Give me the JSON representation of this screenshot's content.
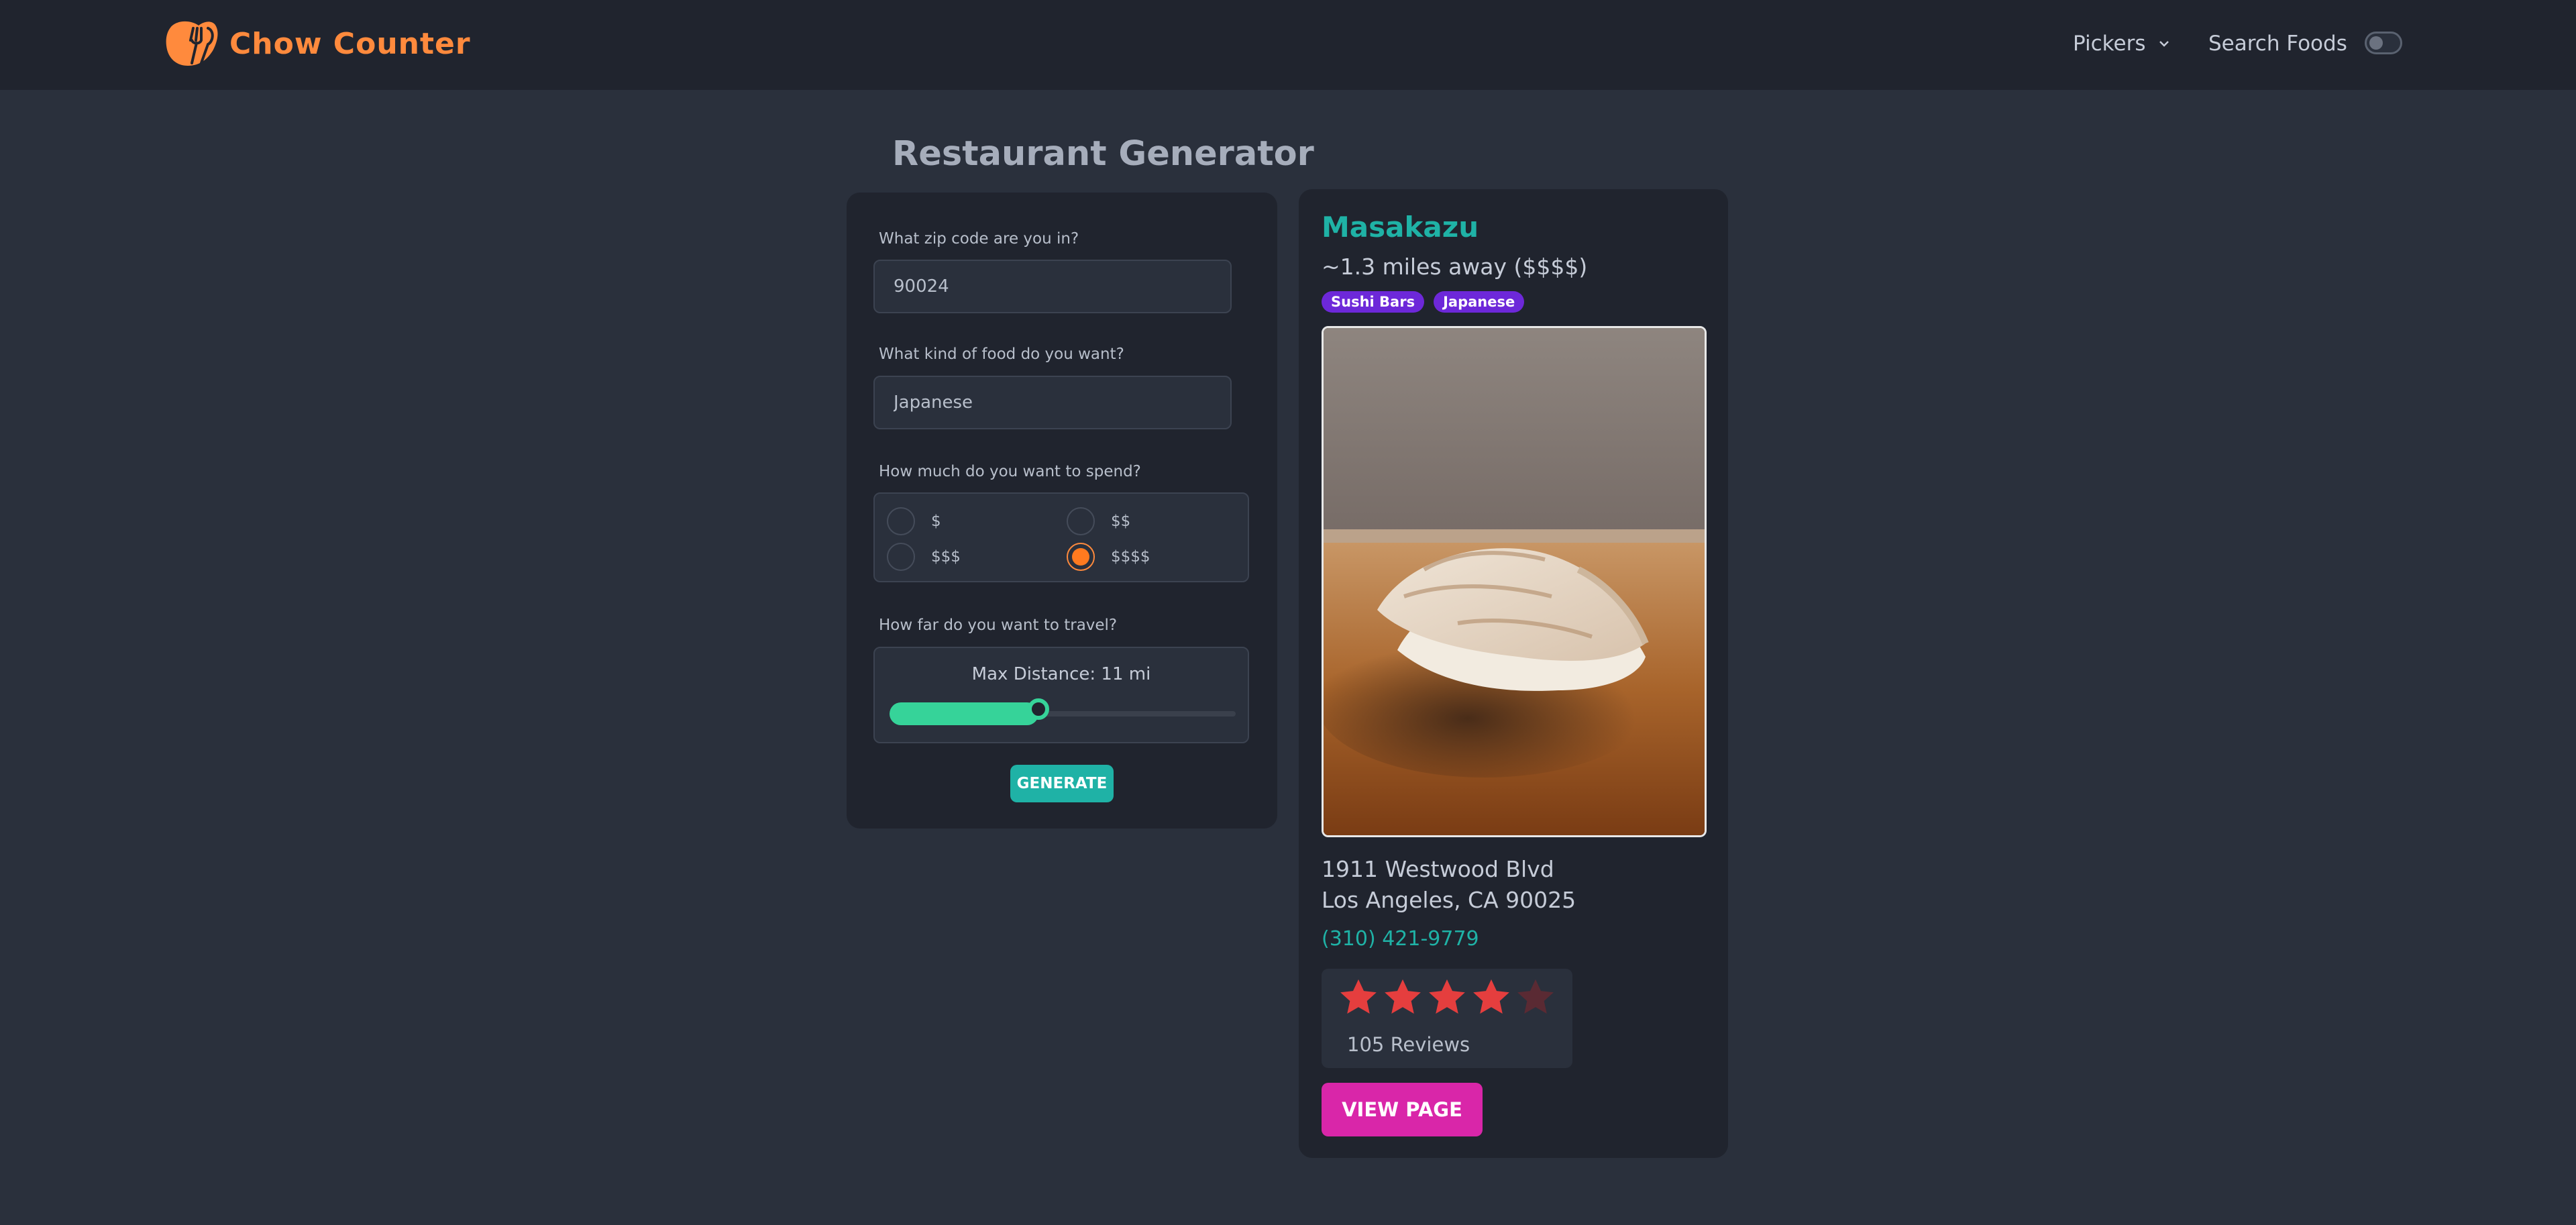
{
  "app": {
    "name": "Chow Counter"
  },
  "nav": {
    "pickers_label": "Pickers",
    "search_label": "Search Foods",
    "dark_mode_on": false
  },
  "page": {
    "title": "Restaurant Generator"
  },
  "form": {
    "zip": {
      "label": "What zip code are you in?",
      "value": "90024"
    },
    "food": {
      "label": "What kind of food do you want?",
      "value": "Japanese"
    },
    "price": {
      "label": "How much do you want to spend?",
      "options": [
        "$",
        "$$",
        "$$$",
        "$$$$"
      ],
      "selected": "$$$$"
    },
    "distance": {
      "label": "How far do you want to travel?",
      "text": "Max Distance: 11 mi",
      "value": 11,
      "fill_fraction": 0.43
    },
    "generate_label": "GENERATE"
  },
  "result": {
    "name": "Masakazu",
    "distance": "~1.3 miles away ($$$$)",
    "tags": [
      "Sushi Bars",
      "Japanese"
    ],
    "address_line1": "1911 Westwood Blvd",
    "address_line2": "Los Angeles, CA 90025",
    "phone": "(310) 421-9779",
    "rating": 4,
    "rating_max": 5,
    "reviews": "105 Reviews",
    "view_label": "VIEW PAGE"
  },
  "colors": {
    "accent_teal": "#1fb2a6",
    "accent_orange": "#ff7a1f",
    "tag_purple": "#6d28d9",
    "button_pink": "#d926a9",
    "star_red": "#e53e3e",
    "slider_green": "#36d399"
  }
}
